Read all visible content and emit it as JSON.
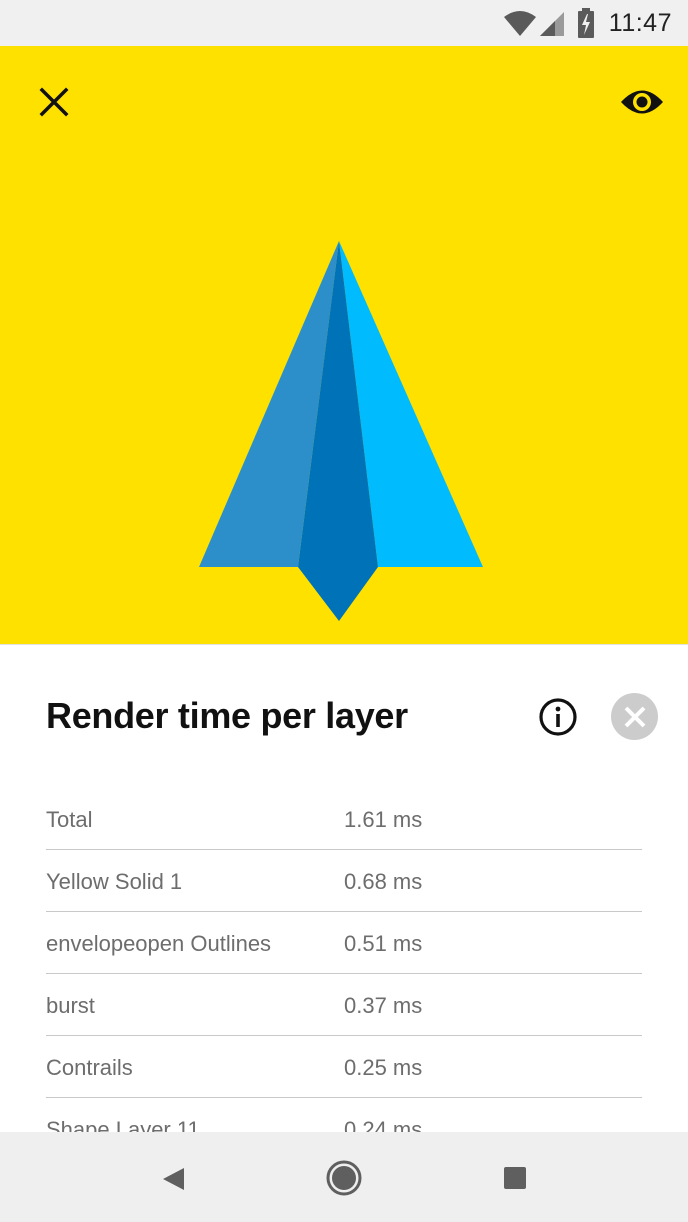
{
  "status_bar": {
    "time": "11:47",
    "icons": [
      "wifi-icon",
      "cell-signal-icon",
      "battery-charging-icon"
    ]
  },
  "preview": {
    "background_color": "#ffe100",
    "close_icon": "close-icon",
    "visibility_icon": "eye-icon",
    "animation_colors": {
      "left_wing": "#2c8fca",
      "right_wing": "#00bcff",
      "center_keel": "#0073b8"
    }
  },
  "sheet": {
    "title": "Render time per layer",
    "info_icon": "info-icon",
    "dismiss_icon": "close-circle-icon",
    "rows": [
      {
        "name": "Total",
        "time": "1.61 ms"
      },
      {
        "name": "Yellow Solid 1",
        "time": "0.68 ms"
      },
      {
        "name": "envelopeopen Outlines",
        "time": "0.51 ms"
      },
      {
        "name": "burst",
        "time": "0.37 ms"
      },
      {
        "name": "Contrails",
        "time": "0.25 ms"
      },
      {
        "name": "Shape Layer 11",
        "time": "0.24 ms"
      }
    ]
  },
  "nav_bar": {
    "icons": [
      "back-icon",
      "home-icon",
      "recents-icon"
    ]
  }
}
